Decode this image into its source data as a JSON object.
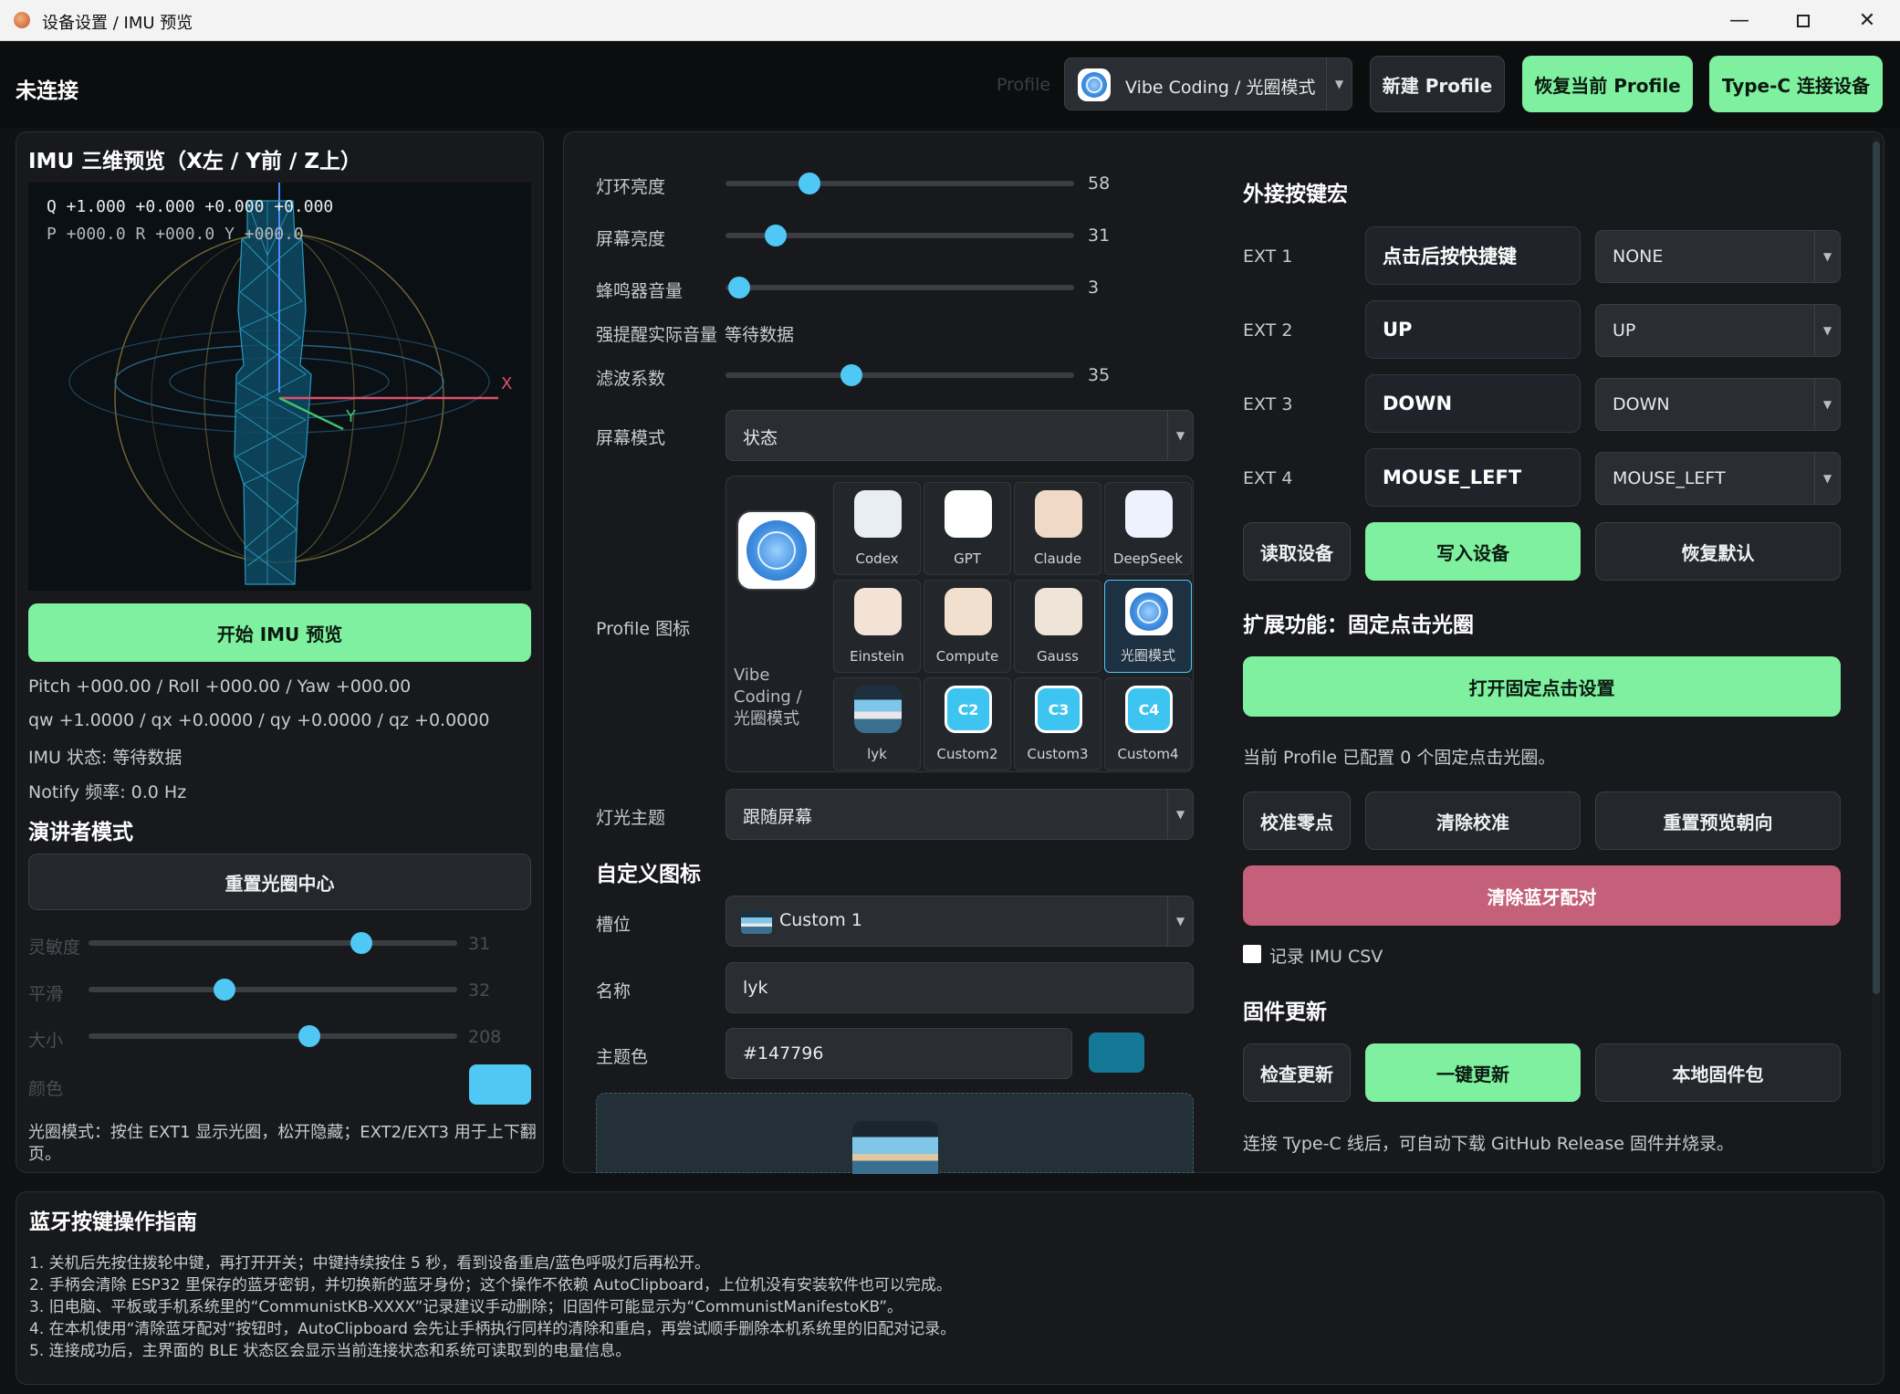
{
  "window": {
    "title": "设备设置 / IMU 预览"
  },
  "header": {
    "connection_status": "未连接",
    "profile_label": "Profile",
    "profile_value": "Vibe Coding / 光圈模式",
    "new_profile": "新建 Profile",
    "restore_profile": "恢复当前 Profile",
    "typec_connect": "Type-C 连接设备"
  },
  "imu": {
    "title": "IMU 三维预览（X左 / Y前 / Z上）",
    "hud_q": "Q +1.000 +0.000 +0.000 +0.000",
    "hud_pry": "P +000.0  R +000.0  Y +000.0",
    "axis_x": "X",
    "axis_y": "Y",
    "start_button": "开始 IMU 预览",
    "pry_line": "Pitch +000.00 / Roll +000.00 / Yaw +000.00",
    "quat_line": "qw +1.0000 / qx +0.0000 / qy +0.0000 / qz +0.0000",
    "status_line": "IMU 状态: 等待数据",
    "notify_line": "Notify 频率: 0.0 Hz"
  },
  "presenter": {
    "title": "演讲者模式",
    "reset_button": "重置光圈中心",
    "sliders": [
      {
        "label": "灵敏度",
        "value": 31,
        "fraction": 0.74
      },
      {
        "label": "平滑",
        "value": 32,
        "fraction": 0.37
      },
      {
        "label": "大小",
        "value": 208,
        "fraction": 0.6
      }
    ],
    "color_label": "颜色",
    "color_value": "#4fc8f5",
    "hint": "光圈模式：按住 EXT1 显示光圈，松开隐藏；EXT2/EXT3 用于上下翻",
    "hint2": "页。"
  },
  "settings": {
    "sliders": [
      {
        "label": "灯环亮度",
        "value": 58,
        "fraction": 0.24
      },
      {
        "label": "屏幕亮度",
        "value": 31,
        "fraction": 0.145
      },
      {
        "label": "蜂鸣器音量",
        "value": 3,
        "fraction": 0.04
      },
      {
        "label": "滤波系数",
        "value": 35,
        "fraction": 0.36
      }
    ],
    "strong_remind_label": "强提醒实际音量",
    "strong_remind_value": "等待数据",
    "screen_mode_label": "屏幕模式",
    "screen_mode_value": "状态",
    "profile_icon_label": "Profile 图标",
    "selected_icon_name_1": "Vibe",
    "selected_icon_name_2": "Coding /",
    "selected_icon_name_3": "光圈模式",
    "icons": [
      {
        "label": "Codex",
        "color": "#e9eef2"
      },
      {
        "label": "GPT",
        "color": "#ffffff"
      },
      {
        "label": "Claude",
        "color": "#f1d9c8"
      },
      {
        "label": "DeepSeek",
        "color": "#eef2ff"
      },
      {
        "label": "Einstein",
        "color": "#f3e3d6"
      },
      {
        "label": "Compute",
        "color": "#f2e0cf"
      },
      {
        "label": "Gauss",
        "color": "#efe4d8"
      },
      {
        "label": "光圈模式",
        "color": "#ffffff"
      },
      {
        "label": "lyk",
        "color": "#2f4a5e"
      },
      {
        "label": "Custom2",
        "color": "#3ec4f0",
        "badge": "C2"
      },
      {
        "label": "Custom3",
        "color": "#3ec4f0",
        "badge": "C3"
      },
      {
        "label": "Custom4",
        "color": "#3ec4f0",
        "badge": "C4"
      }
    ],
    "light_theme_label": "灯光主题",
    "light_theme_value": "跟随屏幕",
    "custom_icon_title": "自定义图标",
    "slot_label": "槽位",
    "slot_value": "Custom 1",
    "name_label": "名称",
    "name_value": "lyk",
    "theme_color_label": "主题色",
    "theme_color_value": "#147796",
    "theme_color_swatch": "#147796"
  },
  "macros": {
    "title": "外接按键宏",
    "rows": [
      {
        "label": "EXT 1",
        "key": "点击后按快捷键",
        "combo": "NONE"
      },
      {
        "label": "EXT 2",
        "key": "UP",
        "combo": "UP"
      },
      {
        "label": "EXT 3",
        "key": "DOWN",
        "combo": "DOWN"
      },
      {
        "label": "EXT 4",
        "key": "MOUSE_LEFT",
        "combo": "MOUSE_LEFT"
      }
    ],
    "read_device": "读取设备",
    "write_device": "写入设备",
    "restore_default": "恢复默认",
    "ext_title": "扩展功能：固定点击光圈",
    "open_fixed": "打开固定点击设置",
    "fixed_status": "当前 Profile 已配置 0 个固定点击光圈。",
    "calibrate_zero": "校准零点",
    "clear_calibration": "清除校准",
    "reset_preview": "重置预览朝向",
    "clear_bt": "清除蓝牙配对",
    "record_csv": "记录 IMU CSV",
    "firmware_title": "固件更新",
    "check_update": "检查更新",
    "one_click_update": "一键更新",
    "local_firmware": "本地固件包",
    "firmware_hint": "连接 Type-C 线后，可自动下载 GitHub Release 固件并烧录。"
  },
  "guide": {
    "title": "蓝牙按键操作指南",
    "lines": [
      "1. 关机后先按住拨轮中键，再打开开关；中键持续按住 5 秒，看到设备重启/蓝色呼吸灯后再松开。",
      "2. 手柄会清除 ESP32 里保存的蓝牙密钥，并切换新的蓝牙身份；这个操作不依赖 AutoClipboard，上位机没有安装软件也可以完成。",
      "3. 旧电脑、平板或手机系统里的“CommunistKB-XXXX”记录建议手动删除；旧固件可能显示为“CommunistManifestoKB”。",
      "4. 在本机使用“清除蓝牙配对”按钮时，AutoClipboard 会先让手柄执行同样的清除和重启，再尝试顺手删除本机系统里的旧配对记录。",
      "5. 连接成功后，主界面的 BLE 状态区会显示当前连接状态和系统可读取到的电量信息。"
    ]
  }
}
